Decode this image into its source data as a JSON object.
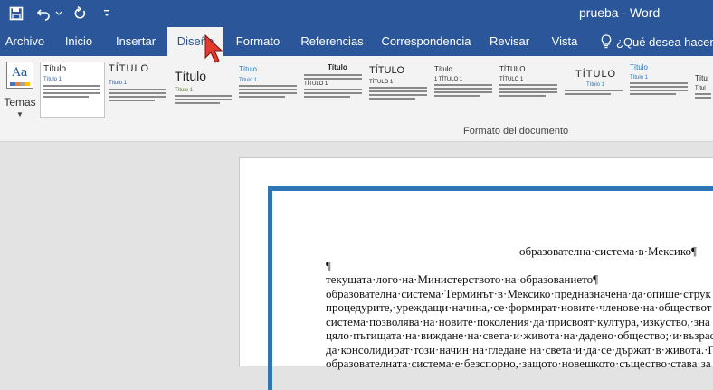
{
  "window": {
    "title": "prueba - Word"
  },
  "qat": {
    "save_icon": "save-icon",
    "undo_icon": "undo-icon",
    "redo_icon": "redo-icon",
    "customize_icon": "customize-qat-icon"
  },
  "tabs": [
    {
      "label": "Archivo"
    },
    {
      "label": "Inicio"
    },
    {
      "label": "Insertar"
    },
    {
      "label": "Diseño",
      "active": true
    },
    {
      "label": "Formato"
    },
    {
      "label": "Referencias"
    },
    {
      "label": "Correspondencia"
    },
    {
      "label": "Revisar"
    },
    {
      "label": "Vista"
    }
  ],
  "tell_me": "¿Qué desea hacer?",
  "ribbon": {
    "temas_label": "Temas",
    "group_label": "Formato del documento",
    "styles": [
      {
        "heading": "Título",
        "sub": "Título 1"
      },
      {
        "heading": "TÍTULO",
        "sub": "Título 1"
      },
      {
        "heading": "Título",
        "sub": "Título 1"
      },
      {
        "heading": "Título",
        "sub": "Título 1"
      },
      {
        "heading": "Título",
        "sub": "TÍTULO 1"
      },
      {
        "heading": "TÍTULO",
        "sub": "TÍTULO 1"
      },
      {
        "heading": "Título",
        "sub": "1 TÍTULO 1"
      },
      {
        "heading": "TÍTULO",
        "sub": "TÍTULO 1"
      },
      {
        "heading": "TÍTULO",
        "sub": "Título 1"
      },
      {
        "heading": "Título",
        "sub": "Título 1"
      },
      {
        "heading": "Títul",
        "sub": "Títul"
      }
    ]
  },
  "document": {
    "lines": [
      "образователна·система·в·Мексико¶",
      "¶",
      "текущата·лого·на·Министерството·на·образованието¶",
      "образователна·система·Терминът·в·Мексико·предназначена·да·опише·струк",
      "процедурите,·уреждащи·начина,·се·формират·новите·членове·на·обществот",
      "система·позволява·на·новите·поколения·да·присвоят·култура,·изкуство,·зна",
      "цяло·пътищата·на·виждане·на·света·и·живота·на·дадено·общество;·и·възрас",
      "да·консолидират·този·начин·на·гледане·на·света·и·да·се·държат·в·живота.·П",
      "образователната·система·е·безспорно,·защото·новешкото·същество·става·за"
    ]
  },
  "colors": {
    "accent": "#2b579a",
    "page_border": "#2e75b6"
  }
}
